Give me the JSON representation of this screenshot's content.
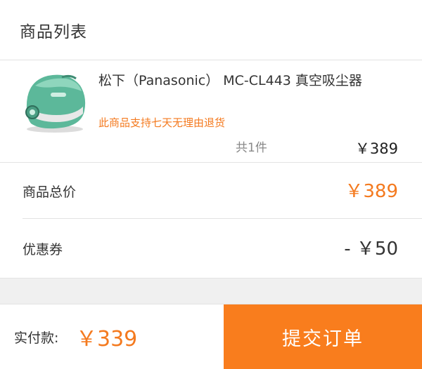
{
  "header": {
    "title": "商品列表"
  },
  "product": {
    "name": "松下（Panasonic） MC-CL443 真空吸尘器",
    "policy": "此商品支持七天无理由退货",
    "quantity": "共1件",
    "price": "￥389",
    "image_icon": "vacuum-cleaner-icon"
  },
  "summary": {
    "total_label": "商品总价",
    "total_value": "￥389",
    "coupon_label": "优惠券",
    "coupon_value": "- ￥50"
  },
  "footer": {
    "paid_label": "实付款:",
    "paid_value": "￥339",
    "submit_label": "提交订单"
  },
  "colors": {
    "accent": "#f97d1d",
    "accent_text": "#f47a1f",
    "background": "#f4f4f4",
    "product_green": "#5cb89a"
  }
}
